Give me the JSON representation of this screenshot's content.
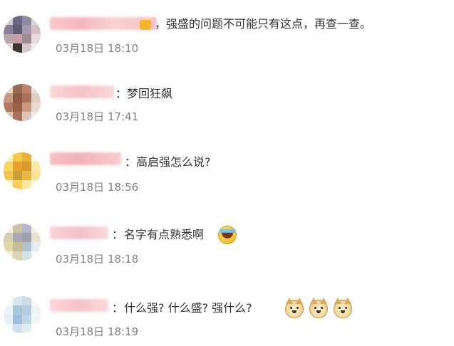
{
  "comments": [
    {
      "text": "强盛的问题不可能只有这点，再查一查。",
      "time": "03月18日 18:10",
      "separator": "，"
    },
    {
      "text": "梦回狂飙",
      "time": "03月18日 17:41",
      "separator": "："
    },
    {
      "text": "高启强怎么说?",
      "time": "03月18日 18:56",
      "separator": "："
    },
    {
      "text": "名字有点熟悉啊",
      "time": "03月18日 18:18",
      "separator": "：",
      "emoji": "crying-laughing-emoji"
    },
    {
      "text": "什么强? 什么盛? 强什么?",
      "time": "03月18日 18:19",
      "separator": "：",
      "emojis": [
        "doge-emoji",
        "doge-emoji",
        "doge-emoji"
      ]
    }
  ]
}
